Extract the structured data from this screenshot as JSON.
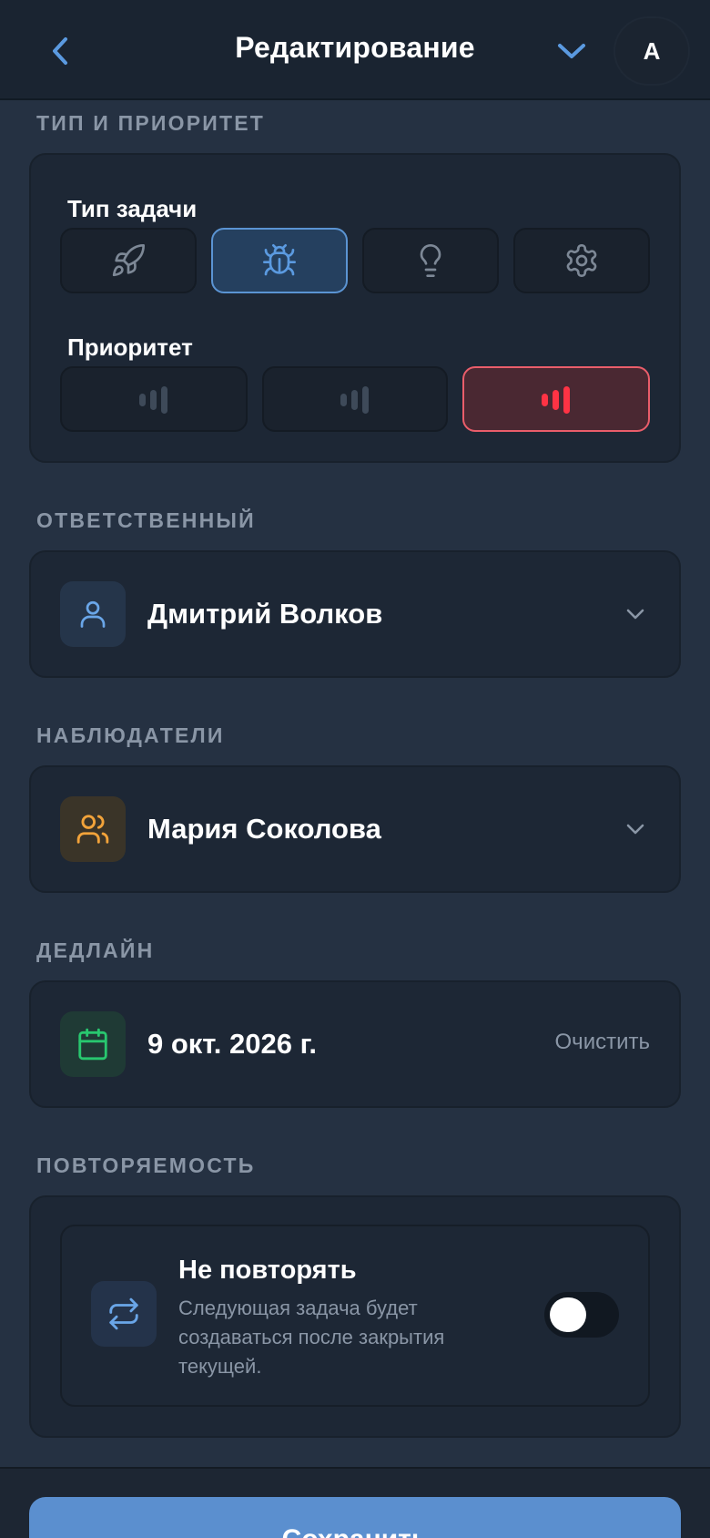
{
  "header": {
    "title": "Редактирование",
    "avatar_initial": "А"
  },
  "type_priority": {
    "section_label": "ТИП И ПРИОРИТЕТ",
    "task_type_label": "Тип задачи",
    "task_types": [
      {
        "icon": "rocket-icon",
        "selected": false
      },
      {
        "icon": "bug-icon",
        "selected": true
      },
      {
        "icon": "lightbulb-icon",
        "selected": false
      },
      {
        "icon": "gear-icon",
        "selected": false
      }
    ],
    "priority_label": "Приоритет",
    "priorities": [
      {
        "icon": "signal-low-icon",
        "selected": false
      },
      {
        "icon": "signal-medium-icon",
        "selected": false
      },
      {
        "icon": "signal-high-icon",
        "selected": true,
        "color": "#ff3344"
      }
    ]
  },
  "assignee": {
    "section_label": "ОТВЕТСТВЕННЫЙ",
    "name": "Дмитрий Волков",
    "icon": "user-icon",
    "icon_color": "#6aa6e8"
  },
  "watchers": {
    "section_label": "НАБЛЮДАТЕЛИ",
    "name": "Мария Соколова",
    "icon": "users-icon",
    "icon_color": "#f2a33a"
  },
  "deadline": {
    "section_label": "ДЕДЛАЙН",
    "date": "9 окт. 2026 г.",
    "clear_label": "Очистить",
    "icon": "calendar-icon",
    "icon_color": "#28c76f"
  },
  "recurrence": {
    "section_label": "ПОВТОРЯЕМОСТЬ",
    "title": "Не повторять",
    "description": "Следующая задача будет создаваться после закрытия текущей.",
    "icon": "repeat-icon",
    "enabled": false
  },
  "footer": {
    "save_label": "Сохранить"
  },
  "colors": {
    "accent": "#5b8fcf",
    "background": "#253142",
    "card": "#1d2735"
  }
}
